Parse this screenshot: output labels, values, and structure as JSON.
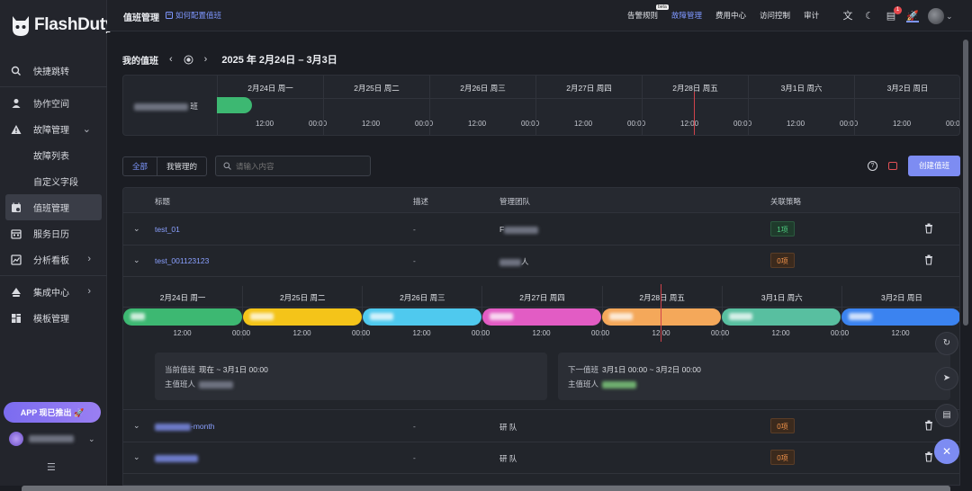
{
  "brand": {
    "name": "FlashDuty"
  },
  "sidebar": {
    "items": [
      {
        "label": "快捷跳转",
        "icon": "search-icon"
      },
      {
        "label": "协作空间",
        "icon": "user-icon"
      },
      {
        "label": "故障管理",
        "icon": "warning-icon",
        "expanded": true
      },
      {
        "label": "故障列表",
        "sub": true
      },
      {
        "label": "自定义字段",
        "sub": true
      },
      {
        "label": "值班管理",
        "icon": "calendar-user-icon",
        "active": true
      },
      {
        "label": "服务日历",
        "icon": "calendar-icon"
      },
      {
        "label": "分析看板",
        "icon": "chart-icon"
      },
      {
        "label": "集成中心",
        "icon": "plug-icon"
      },
      {
        "label": "模板管理",
        "icon": "grid-icon"
      }
    ],
    "app_promo": "APP 现已推出 🚀"
  },
  "topbar": {
    "title": "值班管理",
    "help_link": "如何配置值班",
    "nav": [
      {
        "label": "告警规则",
        "beta": "beta"
      },
      {
        "label": "故障管理",
        "active": true
      },
      {
        "label": "费用中心"
      },
      {
        "label": "访问控制"
      },
      {
        "label": "审计"
      }
    ],
    "notification_count": "1"
  },
  "my_schedule": {
    "title": "我的值班",
    "range": "2025 年 2月24日 – 3月3日",
    "row_label_suffix": "班",
    "days": [
      "2月24日 周一",
      "2月25日 周二",
      "2月26日 周三",
      "2月27日 周四",
      "2月28日 周五",
      "3月1日 周六",
      "3月2日 周日"
    ],
    "hour_labels": [
      "12:00",
      "00:00"
    ]
  },
  "toolbar": {
    "filter_all": "全部",
    "filter_mine": "我管理的",
    "search_placeholder": "请输入内容",
    "create_label": "创建值班",
    "help_glyph": "?"
  },
  "table": {
    "columns": [
      "标题",
      "描述",
      "管理团队",
      "关联策略"
    ],
    "rows": [
      {
        "title": "test_01",
        "desc": "-",
        "team": "F",
        "policy": "1项",
        "policy_color": "green"
      },
      {
        "title": "test_001123123",
        "desc": "-",
        "team": "人",
        "policy": "0项",
        "policy_color": "orange"
      },
      {
        "title": "-month",
        "desc": "-",
        "team": "研 队",
        "policy": "0项",
        "policy_color": "orange"
      },
      {
        "title": "",
        "desc": "-",
        "team": "研 队",
        "policy": "0项",
        "policy_color": "orange"
      }
    ]
  },
  "expanded": {
    "days": [
      "2月24日 周一",
      "2月25日 周二",
      "2月26日 周三",
      "2月27日 周四",
      "2月28日 周五",
      "3月1日 周六",
      "3月2日 周日"
    ],
    "segment_colors": [
      "#3db872",
      "#f4c419",
      "#4fc9ee",
      "#e25cc4",
      "#f4a85a",
      "#58bfa0",
      "#3b83f0"
    ],
    "hour_labels": [
      "12:00",
      "00:00"
    ],
    "current": {
      "label": "当前值班",
      "value": "现在 ~ 3月1日 00:00",
      "owner_label": "主值班人"
    },
    "next": {
      "label": "下一值班",
      "value": "3月1日 00:00 ~ 3月2日 00:00",
      "owner_label": "主值班人"
    }
  },
  "colors": {
    "accent": "#7d8cf2",
    "link": "#8aa0ff",
    "now_line": "#d0434b"
  }
}
